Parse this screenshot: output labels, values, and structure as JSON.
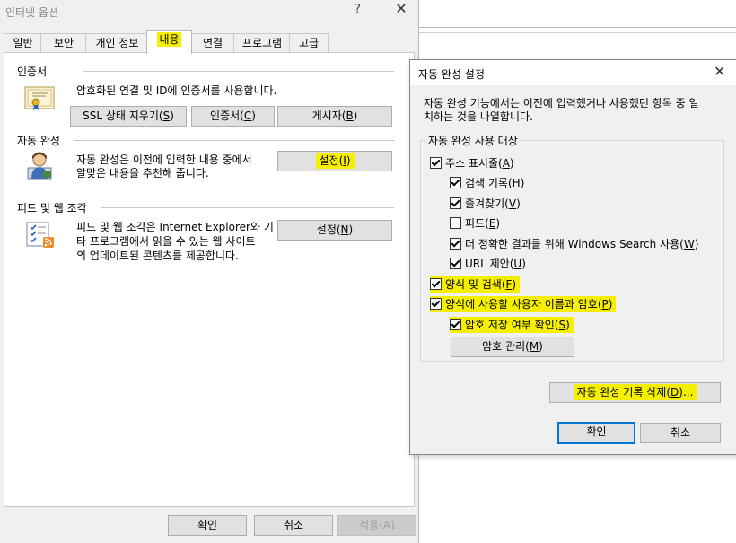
{
  "internet_options": {
    "title": "인터넷 옵션",
    "help_glyph": "?",
    "close_glyph": "✕",
    "tabs": [
      "일반",
      "보안",
      "개인 정보",
      "내용",
      "연결",
      "프로그램",
      "고급"
    ],
    "certificates": {
      "label": "인증서",
      "description": "암호화된 연결 및 ID에 인증서를 사용합니다.",
      "btn_ssl": "SSL 상태 지우기(",
      "btn_ssl_key": "S",
      "btn_cert": "인증서(",
      "btn_cert_key": "C",
      "btn_publisher": "게시자(",
      "btn_publisher_key": "B"
    },
    "autocomplete": {
      "label": "자동 완성",
      "description_1": "자동 완성은 이전에 입력한 내용 중에서",
      "description_2": "알맞은 내용을 추천해 줍니다.",
      "btn_settings": "설정(",
      "btn_settings_key": "I"
    },
    "feeds": {
      "label": "피드 및 웹 조각",
      "description_1": "피드 및 웹 조각은 Internet Explorer와 기",
      "description_2": "타 프로그램에서 읽을 수 있는 웹 사이트",
      "description_3": "의 업데이트된 콘텐츠를 제공합니다.",
      "btn_settings": "설정(",
      "btn_settings_key": "N"
    },
    "footer": {
      "ok": "확인",
      "cancel": "취소",
      "apply": "적용(",
      "apply_key": "A"
    },
    "close_paren": ")"
  },
  "autocomplete_settings": {
    "title": "자동 완성 설정",
    "close_glyph": "✕",
    "intro_1": "자동 완성 기능에서는 이전에 입력했거나 사용했던 항목 중 일",
    "intro_2": "치하는 것을 나열합니다.",
    "group_label": "자동 완성 사용 대상",
    "items": [
      {
        "label": "주소 표시줄(",
        "key": "A",
        "checked": true
      },
      {
        "label": "검색 기록(",
        "key": "H",
        "checked": true
      },
      {
        "label": "즐겨찾기(",
        "key": "V",
        "checked": true
      },
      {
        "label": "피드(",
        "key": "E",
        "checked": false
      },
      {
        "label": "더 정확한 결과를 위해 Windows Search 사용(",
        "key": "W",
        "checked": true
      },
      {
        "label": "URL 제안(",
        "key": "U",
        "checked": true
      },
      {
        "label": "양식 및 검색(",
        "key": "F",
        "checked": true
      },
      {
        "label": "양식에 사용할 사용자 이름과 암호(",
        "key": "P",
        "checked": true
      },
      {
        "label": "암호 저장 여부 확인(",
        "key": "S",
        "checked": true
      }
    ],
    "btn_manage_passwords": "암호 관리(",
    "btn_manage_passwords_key": "M",
    "btn_delete_history": "자동 완성 기록 삭제(",
    "btn_delete_history_key": "D",
    "btn_delete_history_suffix": ")...",
    "ok": "확인",
    "cancel": "취소"
  },
  "colors": {
    "highlight": "#f6f000",
    "default_button_border": "#0078d7",
    "window_bg": "#f0f0f0"
  }
}
